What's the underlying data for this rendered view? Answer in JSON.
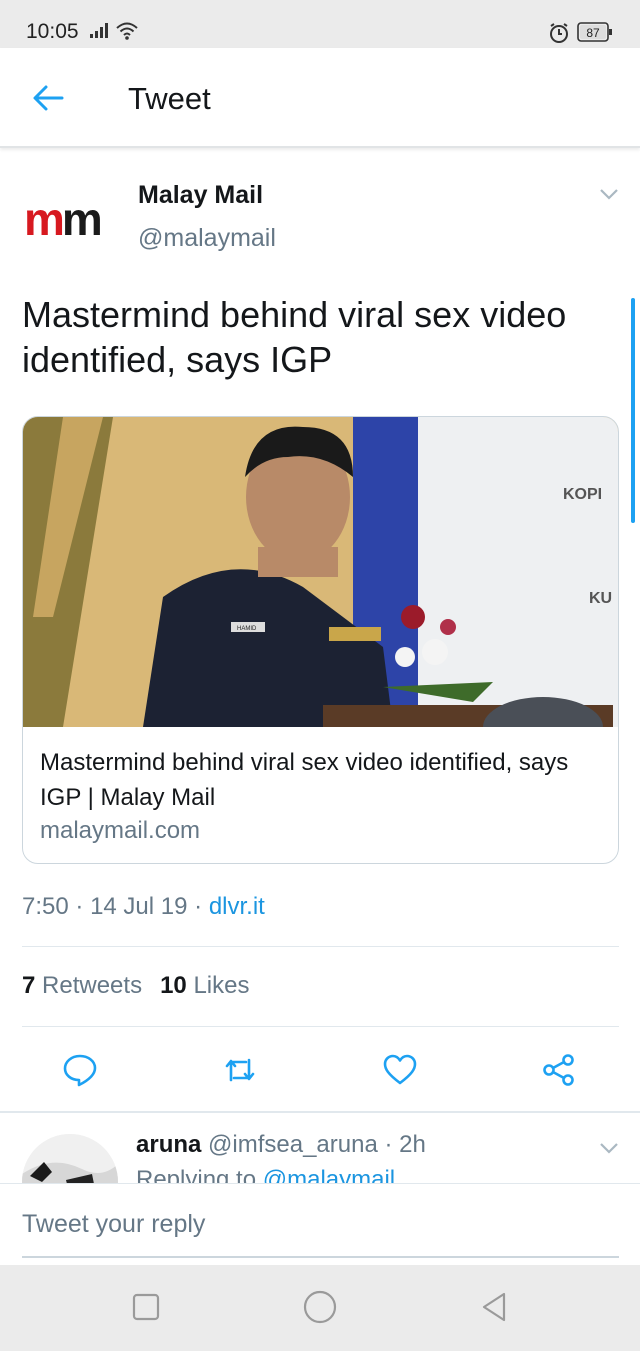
{
  "status_bar": {
    "time": "10:05",
    "battery": "87"
  },
  "header": {
    "title": "Tweet"
  },
  "tweet": {
    "author_name": "Malay Mail",
    "author_handle": "@malaymail",
    "avatar_logo_text_1": "m",
    "avatar_logo_text_2": "m",
    "text": "Mastermind behind viral sex video identified, says IGP",
    "card": {
      "title": "Mastermind behind viral sex video identified, says IGP | Malay Mail",
      "domain": "malaymail.com",
      "image_sign_text_1": "KOPI",
      "image_sign_text_2": "KU",
      "image_badge_text": "HAMID"
    },
    "time": "7:50",
    "date": "14 Jul 19",
    "source": "dlvr.it",
    "separator": "·",
    "retweet_count": "7",
    "retweet_label": "Retweets",
    "like_count": "10",
    "like_label": "Likes"
  },
  "reply": {
    "name": "aruna",
    "handle": "@imfsea_aruna",
    "separator": "·",
    "age": "2h",
    "snippet_prefix": "Replying to",
    "snippet_mention": "@malaymail"
  },
  "compose": {
    "placeholder": "Tweet your reply"
  },
  "colors": {
    "accent": "#1da1f2",
    "link": "#1b95e0",
    "secondary_text": "#657786",
    "logo_red": "#d71920"
  },
  "icons": {
    "back": "arrow-left-icon",
    "menu": "chevron-down-icon",
    "reply": "comment-icon",
    "retweet": "retweet-icon",
    "like": "heart-icon",
    "share": "share-icon",
    "nav_recent": "square-icon",
    "nav_home": "circle-icon",
    "nav_back": "triangle-back-icon"
  }
}
